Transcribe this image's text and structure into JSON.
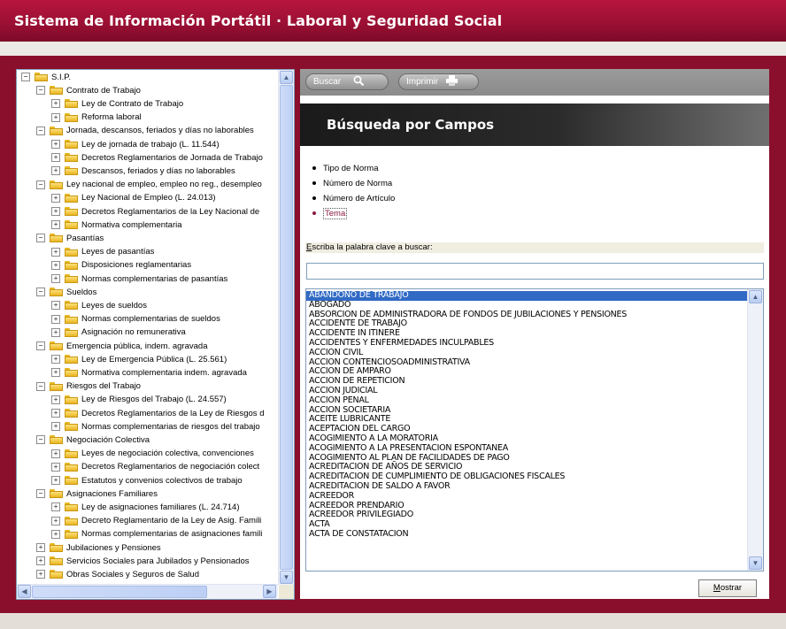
{
  "app": {
    "title": "Sistema de Información Portátil · Laboral y Seguridad Social"
  },
  "toolbar": {
    "buscar_label": "Buscar",
    "buscar_icon": "magnifier-icon",
    "imprimir_label": "Imprimir",
    "imprimir_icon": "printer-icon"
  },
  "page": {
    "heading": "Búsqueda por Campos"
  },
  "search_options": [
    {
      "label": "Tipo de Norma",
      "selected": false
    },
    {
      "label": "Número de Norma",
      "selected": false
    },
    {
      "label": "Número de Artículo",
      "selected": false
    },
    {
      "label": "Tema",
      "selected": true
    }
  ],
  "search": {
    "label": "Escriba la palabra clave a buscar:",
    "value": "",
    "placeholder": ""
  },
  "terms": [
    "ABANDONO DE TRABAJO",
    "ABOGADO",
    "ABSORCION DE ADMINISTRADORA DE FONDOS DE JUBILACIONES Y PENSIONES",
    "ACCIDENTE DE TRABAJO",
    "ACCIDENTE IN ITINERE",
    "ACCIDENTES Y ENFERMEDADES INCULPABLES",
    "ACCION CIVIL",
    "ACCION CONTENCIOSOADMINISTRATIVA",
    "ACCION DE AMPARO",
    "ACCION DE REPETICION",
    "ACCION JUDICIAL",
    "ACCION PENAL",
    "ACCION SOCIETARIA",
    "ACEITE LUBRICANTE",
    "ACEPTACION DEL CARGO",
    "ACOGIMIENTO A LA MORATORIA",
    "ACOGIMIENTO A LA PRESENTACION ESPONTANEA",
    "ACOGIMIENTO AL PLAN DE FACILIDADES DE PAGO",
    "ACREDITACION DE AÑOS DE SERVICIO",
    "ACREDITACION DE CUMPLIMIENTO DE OBLIGACIONES FISCALES",
    "ACREDITACION DE SALDO A FAVOR",
    "ACREEDOR",
    "ACREEDOR PRENDARIO",
    "ACREEDOR PRIVILEGIADO",
    "ACTA",
    "ACTA DE CONSTATACION"
  ],
  "selected_term_index": 0,
  "mostrar_label": "Mostrar",
  "tree": [
    {
      "label": "S.I.P.",
      "depth": 0,
      "expander": "−"
    },
    {
      "label": "Contrato de Trabajo",
      "depth": 1,
      "expander": "−"
    },
    {
      "label": "Ley de Contrato de Trabajo",
      "depth": 2,
      "expander": "+"
    },
    {
      "label": "Reforma laboral",
      "depth": 2,
      "expander": "+"
    },
    {
      "label": "Jornada, descansos, feriados y días no laborables",
      "depth": 1,
      "expander": "−"
    },
    {
      "label": "Ley de jornada de trabajo (L. 11.544)",
      "depth": 2,
      "expander": "+"
    },
    {
      "label": "Decretos Reglamentarios de Jornada de Trabajo",
      "depth": 2,
      "expander": "+"
    },
    {
      "label": "Descansos, feriados y días no laborables",
      "depth": 2,
      "expander": "+"
    },
    {
      "label": "Ley nacional de empleo, empleo no reg., desempleo",
      "depth": 1,
      "expander": "−"
    },
    {
      "label": "Ley Nacional de Empleo (L. 24.013)",
      "depth": 2,
      "expander": "+"
    },
    {
      "label": "Decretos Reglamentarios de la Ley Nacional de",
      "depth": 2,
      "expander": "+"
    },
    {
      "label": "Normativa complementaria",
      "depth": 2,
      "expander": "+"
    },
    {
      "label": "Pasantías",
      "depth": 1,
      "expander": "−"
    },
    {
      "label": "Leyes de pasantías",
      "depth": 2,
      "expander": "+"
    },
    {
      "label": "Disposiciones reglamentarias",
      "depth": 2,
      "expander": "+"
    },
    {
      "label": "Normas complementarias de pasantías",
      "depth": 2,
      "expander": "+"
    },
    {
      "label": "Sueldos",
      "depth": 1,
      "expander": "−"
    },
    {
      "label": "Leyes de sueldos",
      "depth": 2,
      "expander": "+"
    },
    {
      "label": "Normas complementarias de sueldos",
      "depth": 2,
      "expander": "+"
    },
    {
      "label": "Asignación no remunerativa",
      "depth": 2,
      "expander": "+"
    },
    {
      "label": "Emergencia pública, indem. agravada",
      "depth": 1,
      "expander": "−"
    },
    {
      "label": "Ley de Emergencia Pública (L. 25.561)",
      "depth": 2,
      "expander": "+"
    },
    {
      "label": "Normativa complementaria indem. agravada",
      "depth": 2,
      "expander": "+"
    },
    {
      "label": "Riesgos del Trabajo",
      "depth": 1,
      "expander": "−"
    },
    {
      "label": "Ley de Riesgos del Trabajo (L. 24.557)",
      "depth": 2,
      "expander": "+"
    },
    {
      "label": "Decretos Reglamentarios de la Ley de Riesgos d",
      "depth": 2,
      "expander": "+"
    },
    {
      "label": "Normas complementarias de riesgos del trabajo",
      "depth": 2,
      "expander": "+"
    },
    {
      "label": "Negociación Colectiva",
      "depth": 1,
      "expander": "−"
    },
    {
      "label": "Leyes de negociación colectiva, convenciones",
      "depth": 2,
      "expander": "+"
    },
    {
      "label": "Decretos Reglamentarios de negociación colect",
      "depth": 2,
      "expander": "+"
    },
    {
      "label": "Estatutos y convenios colectivos de trabajo",
      "depth": 2,
      "expander": "+"
    },
    {
      "label": "Asignaciones Familiares",
      "depth": 1,
      "expander": "−"
    },
    {
      "label": "Ley de asignaciones familiares (L. 24.714)",
      "depth": 2,
      "expander": "+"
    },
    {
      "label": "Decreto Reglamentario de la Ley de Asig. Famili",
      "depth": 2,
      "expander": "+"
    },
    {
      "label": "Normas complementarias de asignaciones famili",
      "depth": 2,
      "expander": "+"
    },
    {
      "label": "Jubilaciones y Pensiones",
      "depth": 1,
      "expander": "+"
    },
    {
      "label": "Servicios Sociales para Jubilados y Pensionados",
      "depth": 1,
      "expander": "+"
    },
    {
      "label": "Obras Sociales y Seguros de Salud",
      "depth": 1,
      "expander": "+"
    }
  ],
  "colors": {
    "brand": "#9c1034",
    "accent_selected": "#316ac5",
    "selected_option": "#8a1a3c"
  }
}
